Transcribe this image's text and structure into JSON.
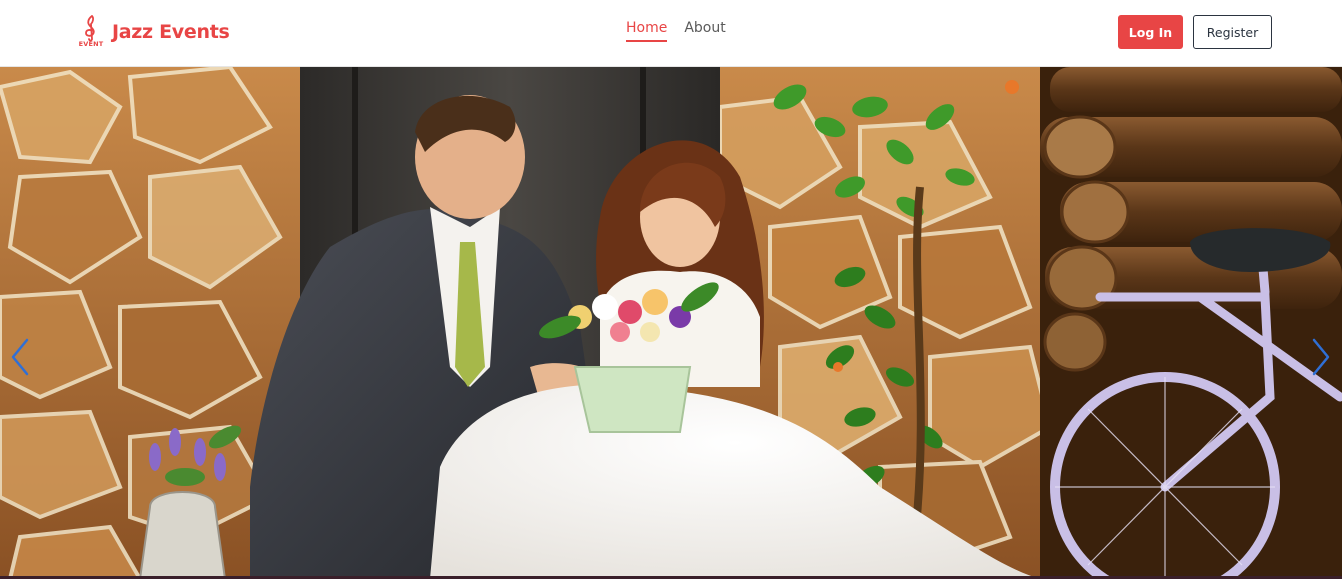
{
  "brand": {
    "name": "Jazz Events",
    "logo_icon": "treble-clef-icon",
    "logo_caption": "EVENT",
    "color": "#e84545"
  },
  "nav": {
    "links": [
      {
        "label": "Home",
        "active": true
      },
      {
        "label": "About",
        "active": false
      }
    ]
  },
  "auth": {
    "login_label": "Log In",
    "register_label": "Register"
  },
  "hero": {
    "image": "wedding-couple-photo",
    "prev_icon": "chevron-left-icon",
    "next_icon": "chevron-right-icon",
    "arrow_color": "#2f6fd6"
  }
}
